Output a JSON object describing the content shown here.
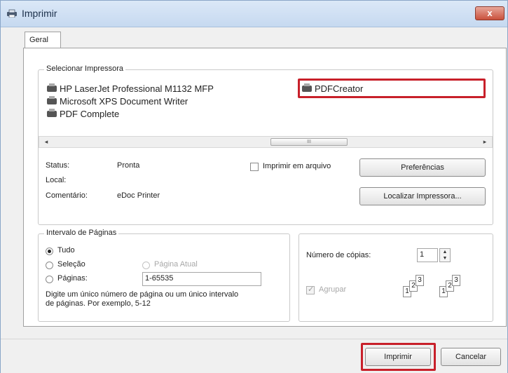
{
  "window": {
    "title": "Imprimir",
    "close_symbol": "x"
  },
  "tabs": [
    {
      "label": "Geral"
    }
  ],
  "select_printer": {
    "legend": "Selecionar Impressora",
    "printers": [
      {
        "name": "HP LaserJet Professional M1132 MFP"
      },
      {
        "name": "Microsoft XPS Document Writer"
      },
      {
        "name": "PDF Complete"
      },
      {
        "name": "PDFCreator",
        "selected": true
      }
    ],
    "scroll_left": "◂",
    "scroll_right": "▸",
    "scroll_thumb_grip": "III",
    "status_label": "Status:",
    "status_value": "Pronta",
    "location_label": "Local:",
    "location_value": "",
    "comment_label": "Comentário:",
    "comment_value": "eDoc Printer",
    "print_to_file_label": "Imprimir em arquivo",
    "print_to_file_checked": false,
    "preferences_button": "Preferências",
    "find_printer_button": "Localizar Impressora..."
  },
  "page_range": {
    "legend": "Intervalo de Páginas",
    "all_label": "Tudo",
    "selection_label": "Seleção",
    "current_page_label": "Página Atual",
    "pages_label": "Páginas:",
    "pages_value": "1-65535",
    "selected": "all",
    "hint": "Digite um único número de página ou um único intervalo de páginas. Por exemplo, 5-12"
  },
  "copies": {
    "label": "Número de cópias:",
    "value": "1",
    "collate_label": "Agrupar",
    "collate_checked": true,
    "collate_enabled": false,
    "spin_up": "▲",
    "spin_down": "▼",
    "collate_pages": [
      "1",
      "2",
      "3",
      "1",
      "2",
      "3"
    ]
  },
  "footer": {
    "print_button": "Imprimir",
    "cancel_button": "Cancelar"
  },
  "colors": {
    "highlight": "#c8202a",
    "titlebar": "#c6d9f0",
    "close": "#c9503c"
  }
}
